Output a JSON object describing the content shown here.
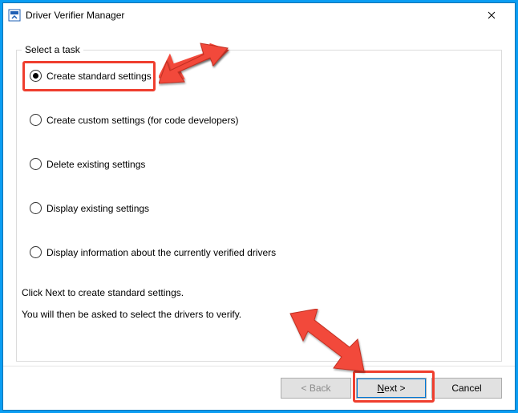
{
  "window": {
    "title": "Driver Verifier Manager",
    "close_icon": "close-icon"
  },
  "task_label": "Select a task",
  "radios": [
    {
      "label": "Create standard settings",
      "checked": true
    },
    {
      "label": "Create custom settings (for code developers)",
      "checked": false
    },
    {
      "label": "Delete existing settings",
      "checked": false
    },
    {
      "label": "Display existing settings",
      "checked": false
    },
    {
      "label": "Display information about the currently verified drivers",
      "checked": false
    }
  ],
  "info_line1": "Click Next to create standard settings.",
  "info_line2": "You will then be asked to select the drivers to verify.",
  "buttons": {
    "back": "< Back",
    "next": "Next >",
    "cancel": "Cancel"
  },
  "annotations": {
    "highlight_color": "#ef3e2e"
  }
}
